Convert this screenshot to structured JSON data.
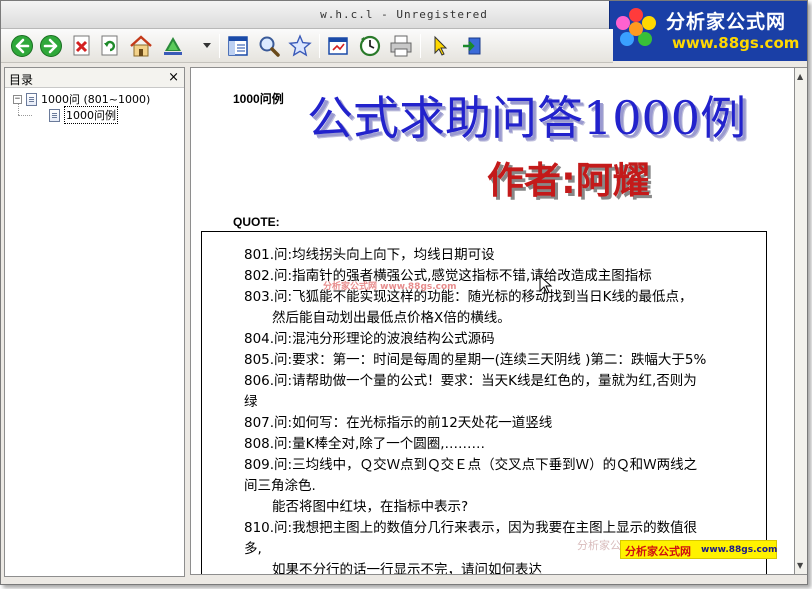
{
  "window": {
    "title": "w.h.c.l - Unregistered"
  },
  "logo": {
    "name": "分析家公式网",
    "url": "www.88gs.com",
    "flower_colors": [
      "#ff3b3b",
      "#ffd800",
      "#38c038",
      "#3aa0ff",
      "#ff62d0",
      "#ff9a1f"
    ]
  },
  "toolbar": {
    "buttons": [
      {
        "name": "back-button",
        "icon": "arrow-left-icon"
      },
      {
        "name": "forward-button",
        "icon": "arrow-right-icon"
      },
      {
        "name": "stop-button",
        "icon": "stop-doc-icon"
      },
      {
        "name": "refresh-button",
        "icon": "refresh-icon"
      },
      {
        "name": "home-button",
        "icon": "home-icon"
      },
      {
        "name": "tree-view-button",
        "icon": "tree-icon"
      },
      {
        "name": "contents-button",
        "icon": "contents-pane-icon"
      },
      {
        "name": "search-button",
        "icon": "magnifier-icon"
      },
      {
        "name": "favorites-button",
        "icon": "star-icon"
      },
      {
        "name": "fullscreen-button",
        "icon": "window-icon"
      },
      {
        "name": "history-button",
        "icon": "clock-icon"
      },
      {
        "name": "print-button",
        "icon": "printer-icon"
      },
      {
        "name": "pointer-button",
        "icon": "cursor-icon"
      },
      {
        "name": "export-button",
        "icon": "export-icon"
      }
    ]
  },
  "sidebar": {
    "title": "目录",
    "close_label": "×",
    "tree": [
      {
        "label": "1000问 (801~1000)",
        "expanded": true
      },
      {
        "label": "1000问例",
        "selected": true
      }
    ]
  },
  "content": {
    "doc_label": "1000问例",
    "big_title": "公式求助问答1000例",
    "author": "作者:阿耀",
    "quote_label": "QUOTE:",
    "watermark_small": "分析家公式网 www.88gs.com",
    "lines": [
      "801.问:均线拐头向上向下，均线日期可设",
      "802.问:指南针的强者横强公式,感觉这指标不错,请给改造成主图指标",
      "803.问:飞狐能不能实现这样的功能：随光标的移动找到当日K线的最低点，",
      "然后能自动划出最低点价格X倍的横线。",
      "804.问:混沌分形理论的波浪结构公式源码",
      "805.问:要求：第一：时间是每周的星期一(连续三天阴线 )第二：跌幅大于5%",
      "806.问:请帮助做一个量的公式！要求：当天K线是红色的，量就为红,否则为",
      "绿",
      "807.问:如何写：在光标指示的前12天处花一道竖线",
      "808.问:量K棒全对,除了一个圆圈,………",
      "809.问:三均线中，Ｑ交Ｗ点到Ｑ交Ｅ点（交叉点下垂到Ｗ）的Ｑ和Ｗ两线之",
      "间三角涂色.",
      "能否将图中红块，在指标中表示?",
      "810.问:我想把主图上的数值分几行来表示，因为我要在主图上显示的数值很",
      "多,",
      "如果不分行的话一行显示不完，请问如何表达"
    ]
  },
  "watermark_bottom": {
    "faded": "分析家公",
    "name": "分析家公式网",
    "url": "www.88gs.com"
  }
}
